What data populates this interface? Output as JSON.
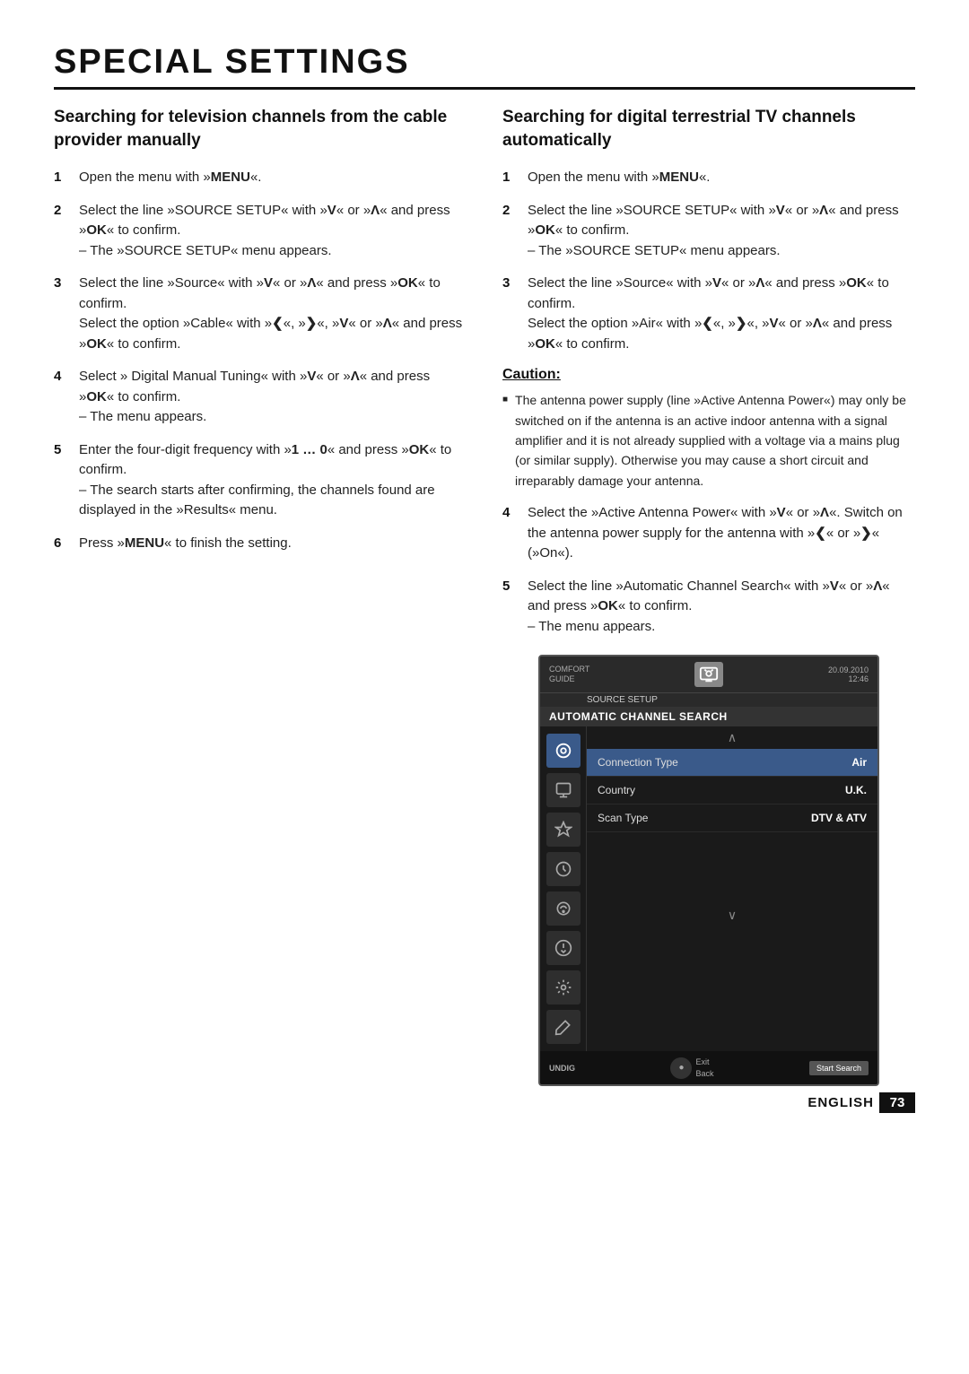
{
  "page": {
    "title": "SPECIAL SETTINGS",
    "footer": {
      "language": "ENGLISH",
      "page_number": "73"
    }
  },
  "left_section": {
    "heading": "Searching for television channels from the cable provider manually",
    "steps": [
      {
        "num": "1",
        "text": "Open the menu with »MENU«."
      },
      {
        "num": "2",
        "text": "Select the line »SOURCE SETUP« with »V« or »Λ« and press »OK« to confirm.\n– The »SOURCE SETUP« menu appears."
      },
      {
        "num": "3",
        "text": "Select the line »Source« with »V« or »Λ« and press »OK« to confirm.\nSelect the option »Cable« with »<«, »>«, »V« or »Λ« and press »OK« to confirm."
      },
      {
        "num": "4",
        "text": "Select » Digital Manual Tuning« with »V« or »Λ« and press »OK« to confirm.\n– The menu appears."
      },
      {
        "num": "5",
        "text": "Enter the four-digit frequency with »1 … 0« and press »OK« to confirm.\n– The search starts after confirming, the channels found are displayed in the »Results« menu."
      },
      {
        "num": "6",
        "text": "Press »MENU« to finish the setting."
      }
    ]
  },
  "right_section": {
    "heading": "Searching for digital terrestrial TV channels automatically",
    "steps": [
      {
        "num": "1",
        "text": "Open the menu with »MENU«."
      },
      {
        "num": "2",
        "text": "Select the line »SOURCE SETUP« with »V« or »Λ« and press »OK« to confirm.\n– The »SOURCE SETUP« menu appears."
      },
      {
        "num": "3",
        "text": "Select the line »Source« with »V« or »Λ« and press »OK« to confirm.\nSelect the option »Air« with »<«, »>«, »V« or »Λ« and press »OK« to confirm."
      }
    ],
    "caution": {
      "heading": "Caution:",
      "text": "The antenna power supply (line »Active Antenna Power«) may only be switched on if the antenna is an active indoor antenna with a signal amplifier and it is not already supplied with a voltage via a mains plug (or similar supply). Otherwise you may cause a short circuit and irreparably damage your antenna."
    },
    "steps_continued": [
      {
        "num": "4",
        "text": "Select the »Active Antenna Power« with »V« or »Λ«. Switch on the antenna power supply for the antenna with »<« or »>« (»On«)."
      },
      {
        "num": "5",
        "text": "Select the line »Automatic Channel Search« with »V« or »Λ« and press »OK« to confirm.\n– The menu appears."
      }
    ]
  },
  "tv_screen": {
    "header_left_top": "COMFORT",
    "header_left_bottom": "GUIDE",
    "header_title_top": "SOURCE SETUP",
    "header_date": "20.09.2010",
    "header_time": "12:46",
    "menu_title": "AUTOMATIC CHANNEL SEARCH",
    "scroll_up": "∧",
    "scroll_down": "∨",
    "menu_rows": [
      {
        "label": "Connection Type",
        "value": "Air",
        "highlighted": true
      },
      {
        "label": "Country",
        "value": "U.K.",
        "highlighted": false
      },
      {
        "label": "Scan Type",
        "value": "DTV & ATV",
        "highlighted": false
      }
    ],
    "footer_btn": "Start Search",
    "footer_exit": "Exit",
    "footer_back": "Back",
    "brand": "UNDIG"
  }
}
